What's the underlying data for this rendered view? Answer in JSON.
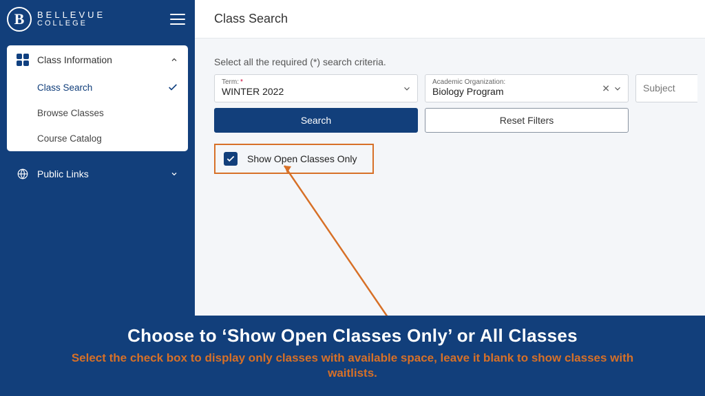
{
  "brand": {
    "name1": "BELLEVUE",
    "name2": "COLLEGE",
    "mark": "B"
  },
  "sidebar": {
    "section_title": "Class Information",
    "items": [
      {
        "label": "Class Search",
        "selected": true
      },
      {
        "label": "Browse Classes",
        "selected": false
      },
      {
        "label": "Course Catalog",
        "selected": false
      }
    ],
    "public_links": "Public Links"
  },
  "page": {
    "title": "Class Search"
  },
  "search": {
    "instruction": "Select all the required (*) search criteria.",
    "term_label": "Term:",
    "term_value": "WINTER 2022",
    "acad_label": "Academic Organization:",
    "acad_value": "Biology Program",
    "subject_label": "Subject",
    "search_btn": "Search",
    "reset_btn": "Reset Filters",
    "checkbox_label": "Show Open Classes Only"
  },
  "banner": {
    "title": "Choose to ‘Show Open Classes Only’ or All Classes",
    "subtitle": "Select the check box to display only classes with available space, leave it blank to show classes with waitlists."
  }
}
